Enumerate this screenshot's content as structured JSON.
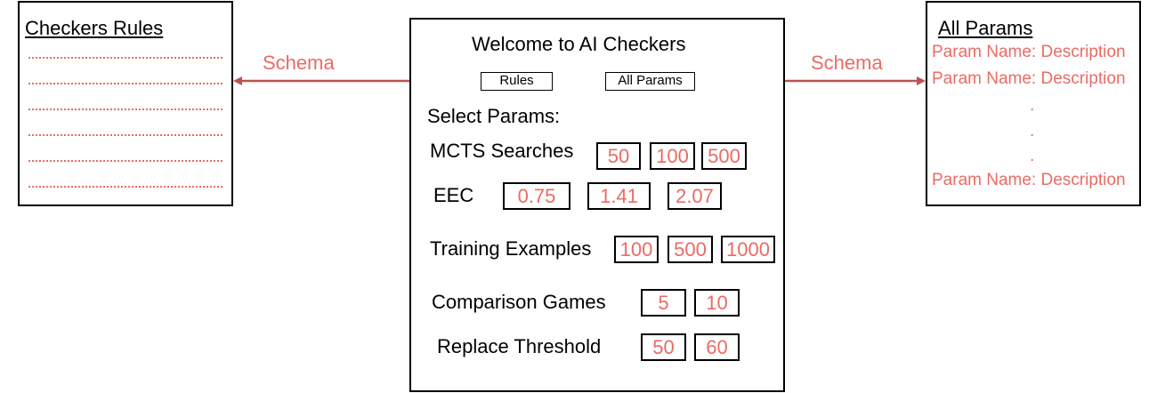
{
  "rules_panel": {
    "title": "Checkers Rules",
    "line_count": 6
  },
  "params_panel": {
    "title": "All Params",
    "items": [
      "Param Name: Description",
      "Param Name: Description",
      ".",
      ".",
      ".",
      "Param Name: Description"
    ]
  },
  "main": {
    "title": "Welcome to AI Checkers",
    "rules_button": "Rules",
    "all_params_button": "All Params",
    "select_label": "Select Params:",
    "params": [
      {
        "label": "MCTS Searches",
        "options": [
          "50",
          "100",
          "500"
        ]
      },
      {
        "label": "EEC",
        "options": [
          "0.75",
          "1.41",
          "2.07"
        ]
      },
      {
        "label": "Training Examples",
        "options": [
          "100",
          "500",
          "1000"
        ]
      },
      {
        "label": "Comparison Games",
        "options": [
          "5",
          "10"
        ]
      },
      {
        "label": "Replace Threshold",
        "options": [
          "50",
          "60"
        ]
      }
    ]
  },
  "arrows": {
    "left_label": "Schema",
    "right_label": "Schema"
  },
  "colors": {
    "accent": "#ea6b66",
    "arrow": "#b85450",
    "border": "#000000"
  }
}
